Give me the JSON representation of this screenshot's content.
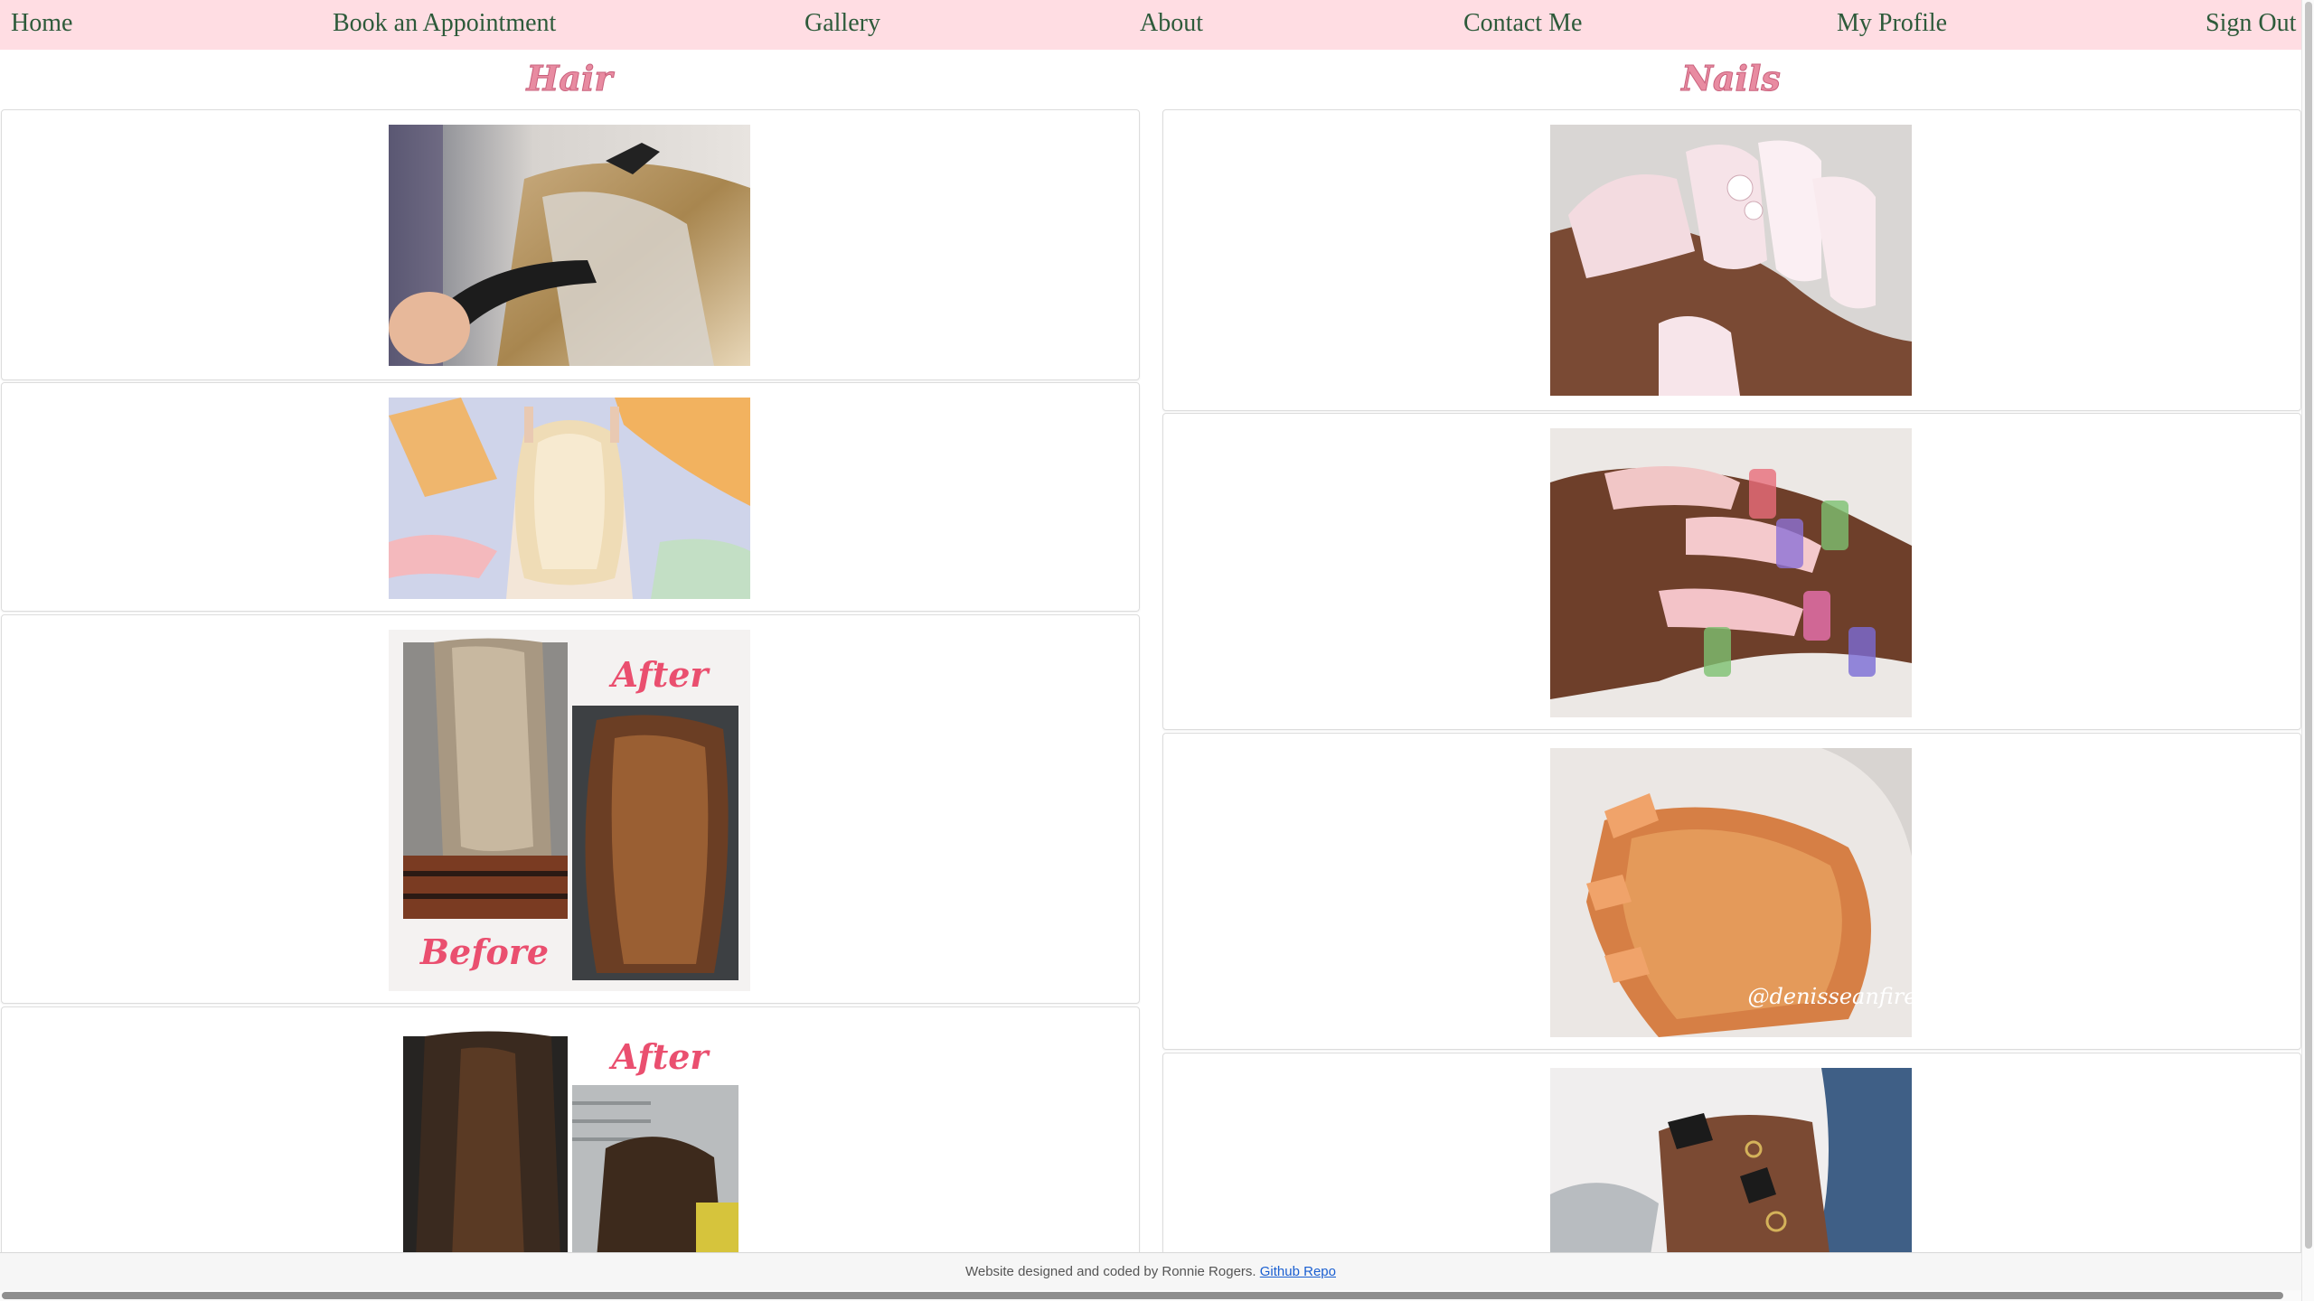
{
  "nav": {
    "items": [
      {
        "label": "Home"
      },
      {
        "label": "Book an Appointment"
      },
      {
        "label": "Gallery"
      },
      {
        "label": "About"
      },
      {
        "label": "Contact Me"
      },
      {
        "label": "My Profile"
      },
      {
        "label": "Sign Out"
      }
    ]
  },
  "gallery": {
    "hair_title": "Hair",
    "nails_title": "Nails",
    "hair_photos": [
      {
        "caption": "",
        "overlay": []
      },
      {
        "caption": "",
        "overlay": []
      },
      {
        "caption": "",
        "overlay": [
          "After",
          "Before"
        ]
      },
      {
        "caption": "",
        "overlay": [
          "After"
        ]
      }
    ],
    "nail_photos": [
      {
        "watermark": ""
      },
      {
        "watermark": ""
      },
      {
        "watermark": "@denisseanfire"
      },
      {
        "watermark": ""
      }
    ]
  },
  "footer": {
    "text": "Website designed and coded by Ronnie Rogers.",
    "link_label": "Github Repo"
  },
  "colors": {
    "nav_bg": "#ffdde3",
    "nav_text": "#2d5a3a",
    "title_pink": "#e88ba1",
    "link_blue": "#1a5fd1"
  }
}
